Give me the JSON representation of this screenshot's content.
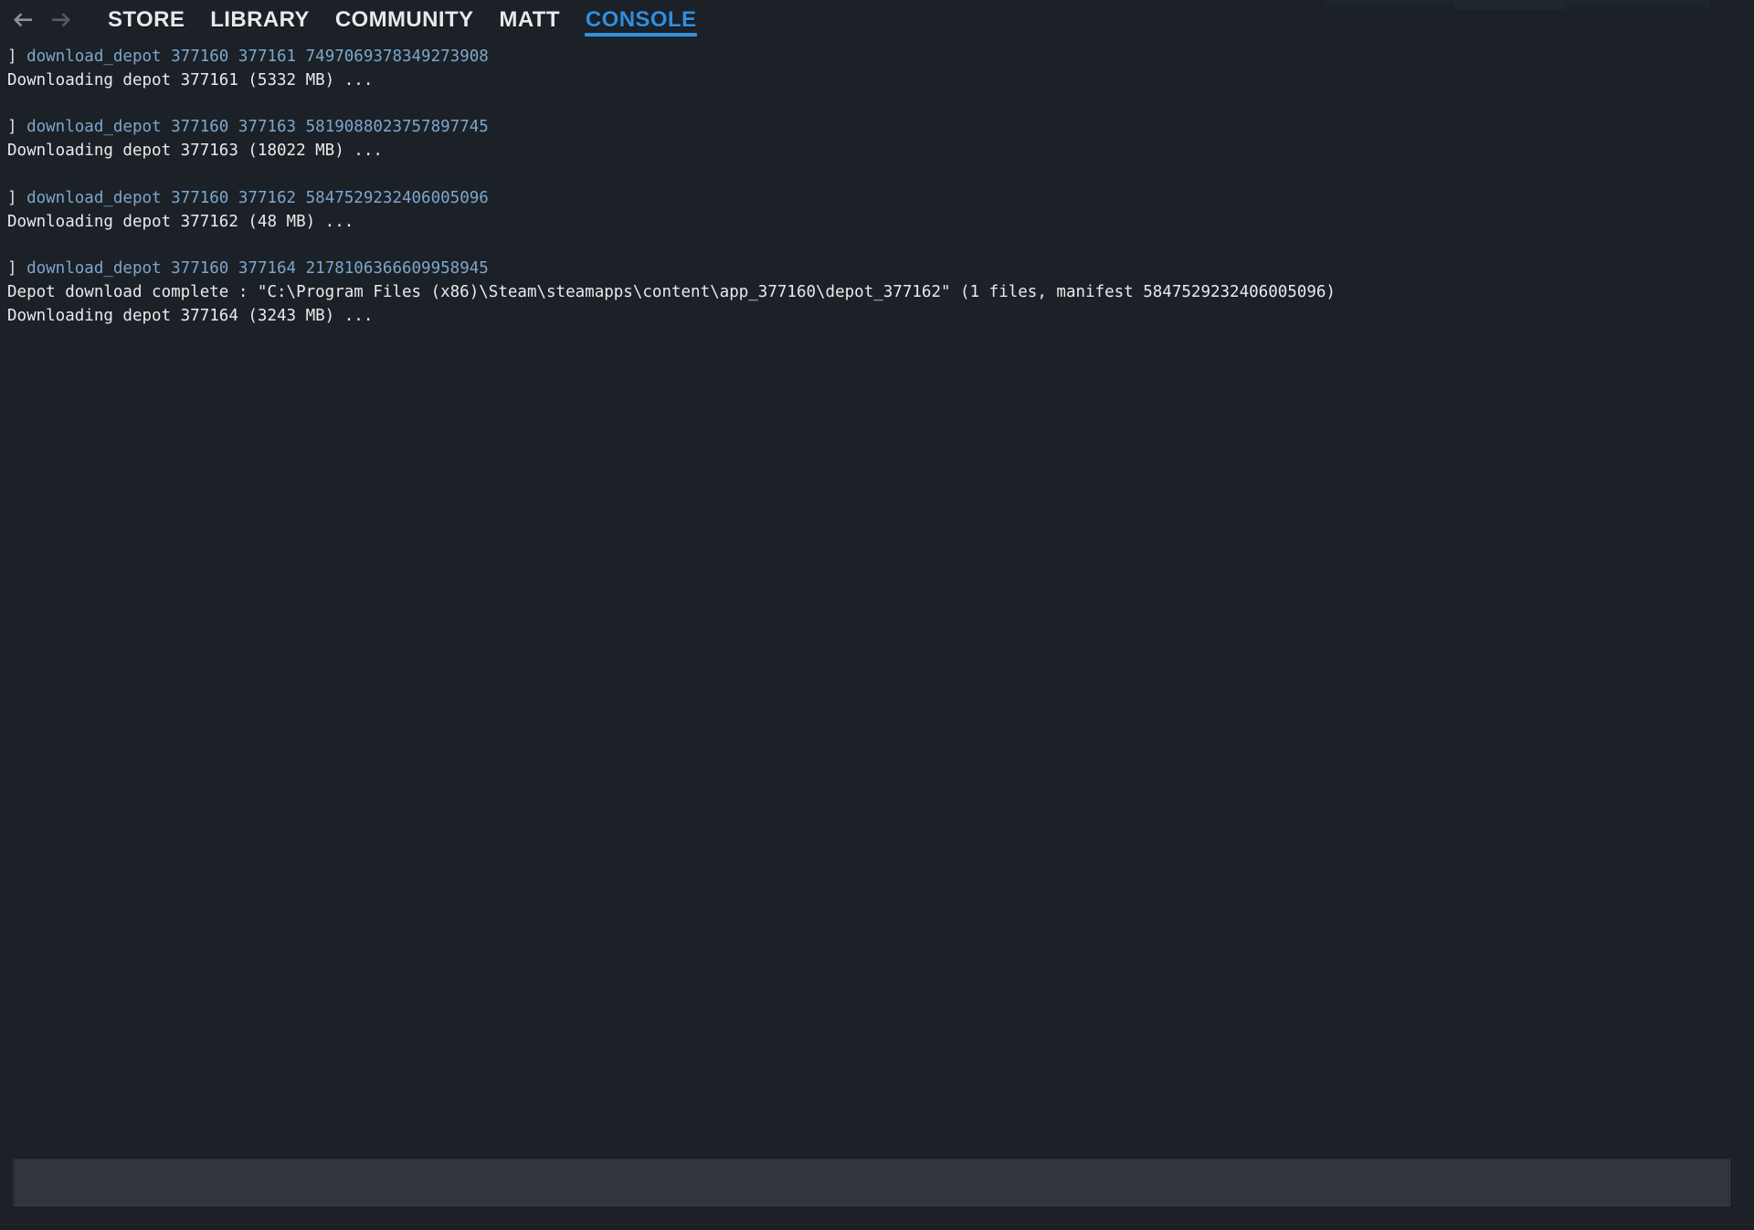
{
  "window": {
    "background_color": "#1b2127",
    "accent_color": "#2f8fe0"
  },
  "navbar": {
    "back_arrow": "back-arrow",
    "forward_arrow": "forward-arrow",
    "tabs": [
      {
        "label": "STORE",
        "active": false
      },
      {
        "label": "LIBRARY",
        "active": false
      },
      {
        "label": "COMMUNITY",
        "active": false
      },
      {
        "label": "MATT",
        "active": false
      },
      {
        "label": "CONSOLE",
        "active": true
      }
    ]
  },
  "console": {
    "lines": [
      {
        "type": "command",
        "prompt": "] ",
        "text": "download_depot 377160 377161 7497069378349273908"
      },
      {
        "type": "output",
        "text": "Downloading depot 377161 (5332 MB) ..."
      },
      {
        "type": "blank",
        "text": ""
      },
      {
        "type": "command",
        "prompt": "] ",
        "text": "download_depot 377160 377163 5819088023757897745"
      },
      {
        "type": "output",
        "text": "Downloading depot 377163 (18022 MB) ..."
      },
      {
        "type": "blank",
        "text": ""
      },
      {
        "type": "command",
        "prompt": "] ",
        "text": "download_depot 377160 377162 5847529232406005096"
      },
      {
        "type": "output",
        "text": "Downloading depot 377162 (48 MB) ..."
      },
      {
        "type": "blank",
        "text": ""
      },
      {
        "type": "command",
        "prompt": "] ",
        "text": "download_depot 377160 377164 2178106366609958945"
      },
      {
        "type": "output",
        "text": "Depot download complete : \"C:\\Program Files (x86)\\Steam\\steamapps\\content\\app_377160\\depot_377162\" (1 files, manifest 5847529232406005096)"
      },
      {
        "type": "output",
        "text": "Downloading depot 377164 (3243 MB) ..."
      }
    ]
  },
  "input": {
    "value": "",
    "placeholder": ""
  }
}
